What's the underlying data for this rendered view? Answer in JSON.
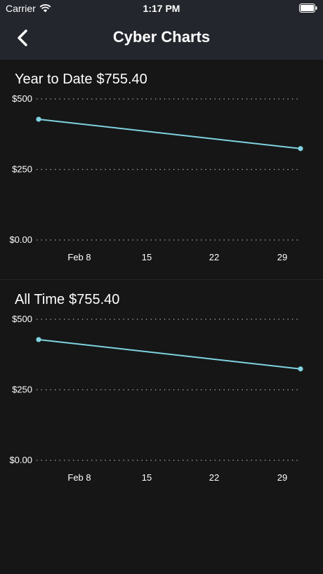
{
  "status_bar": {
    "carrier": "Carrier",
    "time": "1:17 PM",
    "wifi_icon": "wifi-icon",
    "battery_icon": "battery-icon"
  },
  "nav": {
    "title": "Cyber Charts",
    "back_icon": "chevron-left-icon"
  },
  "colors": {
    "background": "#161616",
    "nav_background": "#24262d",
    "line": "#7fd3e0",
    "grid": "#bdbdbd"
  },
  "charts": [
    {
      "label": "Year to Date",
      "value": "$755.40"
    },
    {
      "label": "All Time",
      "value": "$755.40"
    }
  ],
  "chart_data": [
    {
      "type": "line",
      "title": "Year to Date $755.40",
      "x": [
        "2020-02-02",
        "2020-03-01"
      ],
      "y": [
        428,
        324
      ],
      "xticks": [
        "Feb 8",
        "15",
        "22",
        "29"
      ],
      "yticks": [
        "$0.00",
        "$250",
        "$500"
      ],
      "ylim": [
        0,
        500
      ],
      "grid": true
    },
    {
      "type": "line",
      "title": "All Time $755.40",
      "x": [
        "2020-02-02",
        "2020-03-01"
      ],
      "y": [
        428,
        324
      ],
      "xticks": [
        "Feb 8",
        "15",
        "22",
        "29"
      ],
      "yticks": [
        "$0.00",
        "$250",
        "$500"
      ],
      "ylim": [
        0,
        500
      ],
      "grid": true
    }
  ]
}
